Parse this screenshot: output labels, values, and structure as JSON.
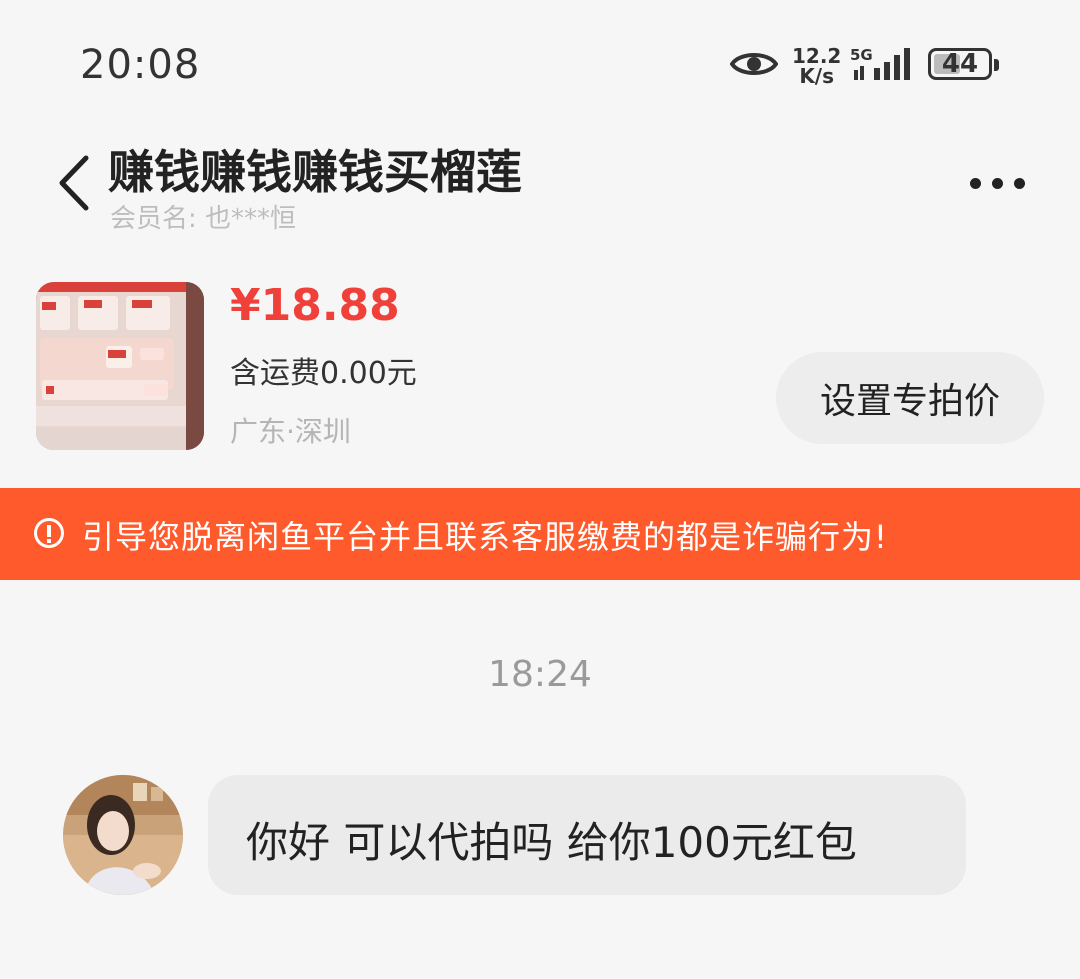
{
  "status_bar": {
    "time": "20:08",
    "net_speed_value": "12.2",
    "net_speed_unit": "K/s",
    "network": "5G",
    "battery": "44",
    "icons": [
      "eye-icon",
      "signal-icon",
      "battery-icon"
    ]
  },
  "header": {
    "title": "赚钱赚钱赚钱买榴莲",
    "member_label": "会员名: 也***恒"
  },
  "product": {
    "price": "¥18.88",
    "shipping": "含运费0.00元",
    "location": "广东·深圳",
    "set_price_button": "设置专拍价"
  },
  "warning_banner": {
    "text": "引导您脱离闲鱼平台并且联系客服缴费的都是诈骗行为!",
    "color": "#ff5a2c"
  },
  "chat": {
    "timestamp": "18:24",
    "messages": [
      {
        "text": "你好 可以代拍吗 给你100元红包"
      }
    ]
  },
  "colors": {
    "price": "#f0403a",
    "banner": "#ff5a2c",
    "background": "#f6f6f6",
    "bubble": "#ebebeb"
  }
}
